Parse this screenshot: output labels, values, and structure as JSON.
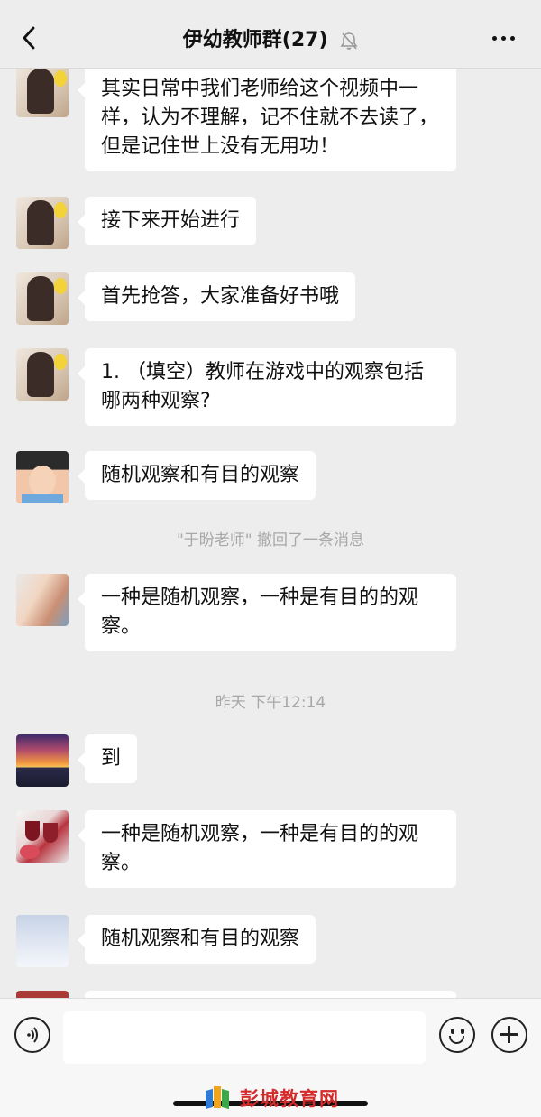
{
  "header": {
    "title": "伊幼教师群",
    "member_count": "(27)",
    "back_icon": "chevron-left-icon",
    "mute_icon": "bell-off-icon",
    "more_icon": "more-dots-icon"
  },
  "messages": [
    {
      "avatar": "girl-with-flower",
      "text": "其实日常中我们老师给这个视频中一样，认为不理解，记不住就不去读了，但是记住世上没有无用功！"
    },
    {
      "avatar": "girl-with-flower",
      "text": "接下来开始进行"
    },
    {
      "avatar": "girl-with-flower",
      "text": "首先抢答，大家准备好书哦"
    },
    {
      "avatar": "girl-with-flower",
      "text": "1. （填空）教师在游戏中的观察包括哪两种观察?"
    },
    {
      "avatar": "smiling-child",
      "text": "随机观察和有目的观察"
    },
    {
      "avatar": "child-drinking",
      "text": "一种是随机观察，一种是有目的的观察。"
    },
    {
      "avatar": "sunset",
      "text": "到"
    },
    {
      "avatar": "wine-glasses",
      "text": "一种是随机观察，一种是有目的的观察。"
    },
    {
      "avatar": "cloudy-sky",
      "text": "随机观察和有目的观察"
    }
  ],
  "system_messages": {
    "recall": "\"于盼老师\" 撤回了一条消息",
    "timestamp": "昨天 下午12:14"
  },
  "inputbar": {
    "voice_icon": "voice-icon",
    "emoji_icon": "emoji-icon",
    "plus_icon": "plus-circle-icon",
    "input_value": ""
  },
  "watermark": {
    "text": "彭城教育网"
  }
}
